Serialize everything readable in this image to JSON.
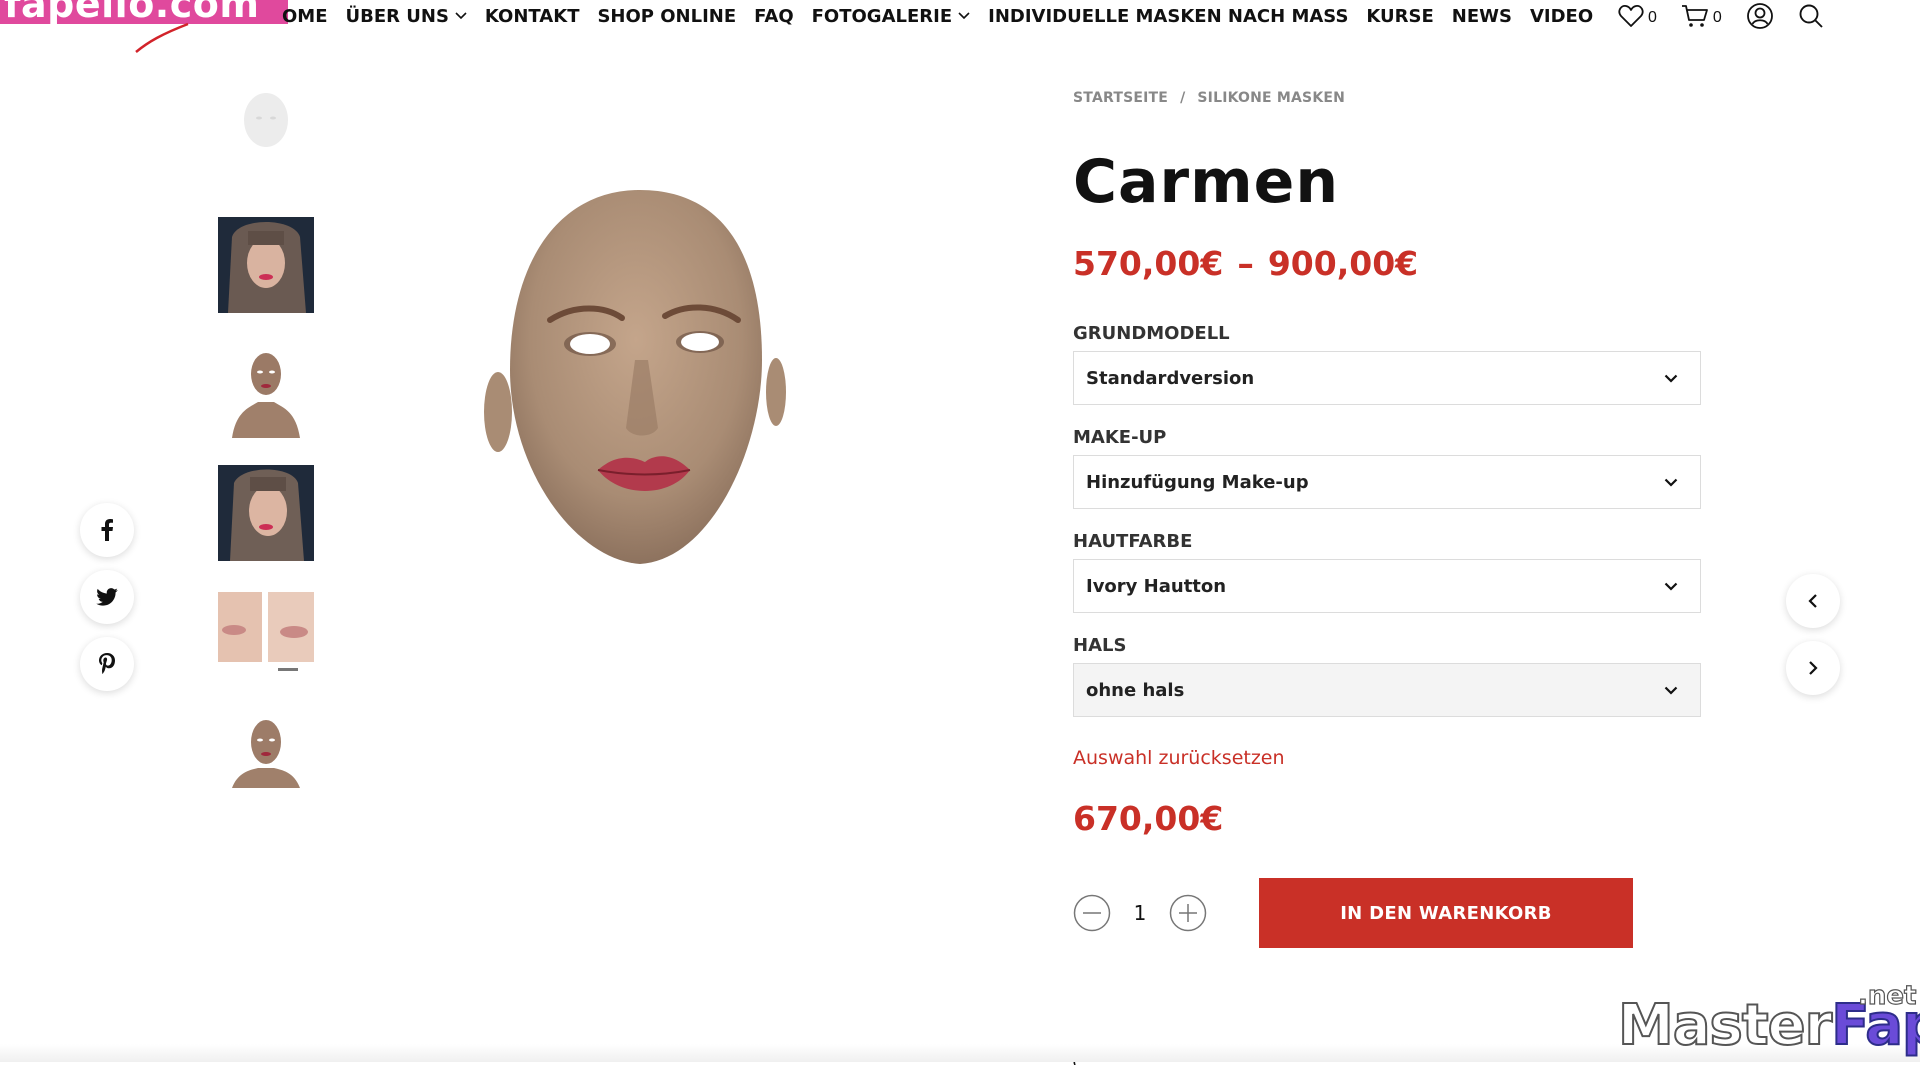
{
  "watermark_top": {
    "text": "fapello.com"
  },
  "nav": {
    "items": [
      {
        "label": "HOME",
        "dropdown": false
      },
      {
        "label": "ÜBER UNS",
        "dropdown": true
      },
      {
        "label": "KONTAKT",
        "dropdown": false
      },
      {
        "label": "SHOP ONLINE",
        "dropdown": false
      },
      {
        "label": "FAQ",
        "dropdown": false
      },
      {
        "label": "FOTOGALERIE",
        "dropdown": true
      },
      {
        "label": "INDIVIDUELLE MASKEN NACH MASS",
        "dropdown": false
      },
      {
        "label": "KURSE",
        "dropdown": false
      },
      {
        "label": "NEWS",
        "dropdown": false
      },
      {
        "label": "VIDEO",
        "dropdown": false
      }
    ],
    "visible_home_label": "OME"
  },
  "header_icons": {
    "wishlist_count": "0",
    "cart_count": "0",
    "icons": [
      "heart-icon",
      "cart-icon",
      "account-icon",
      "search-icon"
    ]
  },
  "gallery": {
    "thumbnails": [
      {
        "alt": "white mask front"
      },
      {
        "alt": "mask with brown hair"
      },
      {
        "alt": "mask on stand with neck"
      },
      {
        "alt": "mask with brown hair side"
      },
      {
        "alt": "lips close-up detail"
      },
      {
        "alt": "mask on stand"
      }
    ]
  },
  "social": {
    "icons": [
      "facebook-icon",
      "twitter-icon",
      "pinterest-icon"
    ]
  },
  "breadcrumb": {
    "items": [
      "STARTSEITE",
      "SILIKONE MASKEN"
    ],
    "separator": "/"
  },
  "product": {
    "title": "Carmen",
    "price_min": "570,00€",
    "price_sep": "–",
    "price_max": "900,00€"
  },
  "variations": [
    {
      "label": "GRUNDMODELL",
      "value": "Standardversion"
    },
    {
      "label": "MAKE-UP",
      "value": "Hinzufügung Make-up"
    },
    {
      "label": "HAUTFARBE",
      "value": "Ivory Hautton"
    },
    {
      "label": "HALS",
      "value": "ohne hals"
    }
  ],
  "reset_label": "Auswahl zurücksetzen",
  "variant_price": "670,00€",
  "cart": {
    "quantity": "1",
    "add_to_cart_label": "IN DEN WARENKORB"
  },
  "watermark_bottom": {
    "main": "Master",
    "accent": "Fap",
    "suffix": ".net"
  },
  "colors": {
    "accent_red": "#c93027",
    "text_dark": "#111111",
    "watermark_pink": "#e0499d"
  }
}
